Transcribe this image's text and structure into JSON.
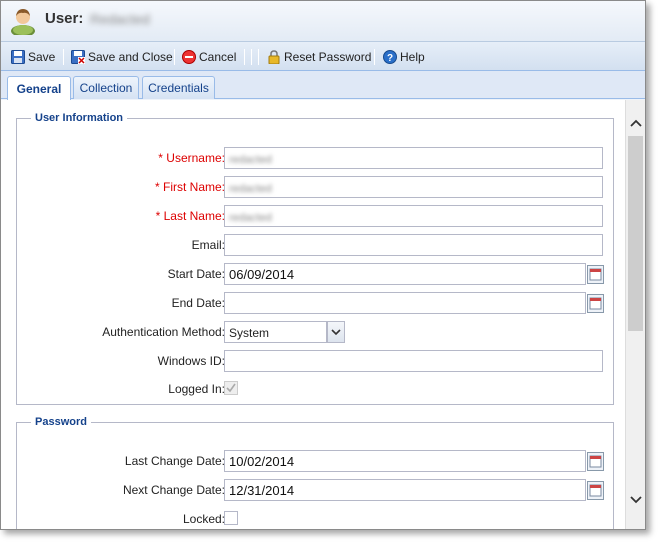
{
  "window": {
    "title_label": "User:",
    "title_user": "Redacted"
  },
  "toolbar": {
    "save_label": "Save",
    "save_close_label": "Save and Close",
    "cancel_label": "Cancel",
    "reset_password_label": "Reset Password",
    "help_label": "Help"
  },
  "tabs": [
    {
      "label": "General",
      "active": true
    },
    {
      "label": "Collection",
      "active": false
    },
    {
      "label": "Credentials",
      "active": false
    }
  ],
  "user_information": {
    "legend": "User Information",
    "username": {
      "label": "* Username:",
      "value": "redacted"
    },
    "first_name": {
      "label": "* First Name:",
      "value": "redacted"
    },
    "last_name": {
      "label": "* Last Name:",
      "value": "redacted"
    },
    "email": {
      "label": "Email:",
      "value": ""
    },
    "start_date": {
      "label": "Start Date:",
      "value": "06/09/2014"
    },
    "end_date": {
      "label": "End Date:",
      "value": ""
    },
    "auth_method": {
      "label": "Authentication Method:",
      "value": "System"
    },
    "windows_id": {
      "label": "Windows ID:",
      "value": ""
    },
    "logged_in": {
      "label": "Logged In:",
      "checked": true
    }
  },
  "password": {
    "legend": "Password",
    "last_change_date": {
      "label": "Last Change Date:",
      "value": "10/02/2014"
    },
    "next_change_date": {
      "label": "Next Change Date:",
      "value": "12/31/2014"
    },
    "locked": {
      "label": "Locked:",
      "checked": false
    }
  },
  "colors": {
    "required": "#dd0000",
    "legend": "#15428b",
    "tab_text": "#15428b"
  },
  "icons": {
    "title": "user-avatar-icon",
    "save": "floppy-disk-icon",
    "save_close": "floppy-disk-close-icon",
    "cancel": "cancel-circle-icon",
    "reset_password": "padlock-icon",
    "help": "help-circle-icon",
    "calendar": "calendar-icon",
    "dropdown": "chevron-down-icon"
  }
}
